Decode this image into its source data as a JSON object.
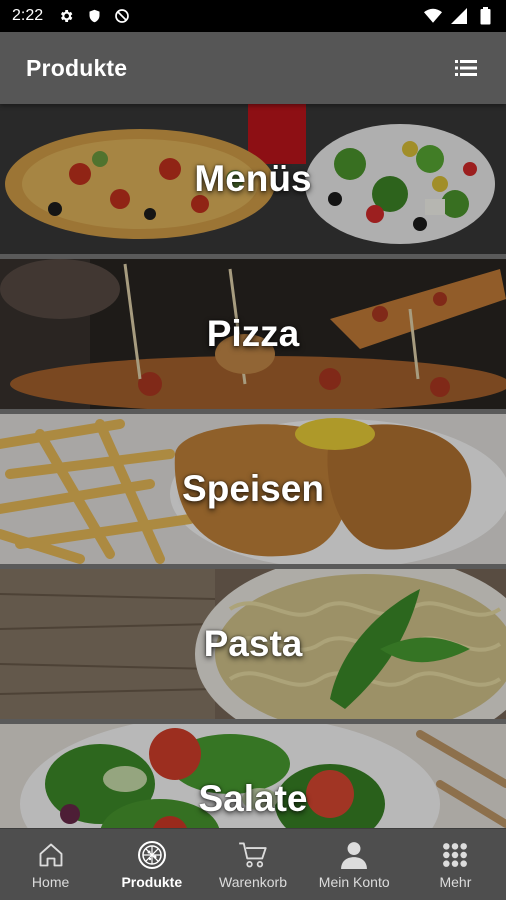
{
  "status_bar": {
    "time": "2:22",
    "left_icons": [
      "gear-icon",
      "shield-icon",
      "blocked-icon"
    ],
    "right_icons": [
      "wifi-icon",
      "signal-icon",
      "battery-icon"
    ]
  },
  "app_bar": {
    "title": "Produkte",
    "action_icon": "list-icon"
  },
  "categories": [
    {
      "label": "Menüs"
    },
    {
      "label": "Pizza"
    },
    {
      "label": "Speisen"
    },
    {
      "label": "Pasta"
    },
    {
      "label": "Salate"
    }
  ],
  "bottom_nav": {
    "items": [
      {
        "label": "Home",
        "icon": "home-icon"
      },
      {
        "label": "Produkte",
        "icon": "pizza-icon",
        "active": true
      },
      {
        "label": "Warenkorb",
        "icon": "cart-icon"
      },
      {
        "label": "Mein Konto",
        "icon": "person-icon"
      },
      {
        "label": "Mehr",
        "icon": "grid-icon"
      }
    ]
  },
  "colors": {
    "app_bar": "#565656",
    "status_bar": "#000000",
    "bottom_nav": "#4e4e4e",
    "active_nav_text": "#ffffff"
  }
}
